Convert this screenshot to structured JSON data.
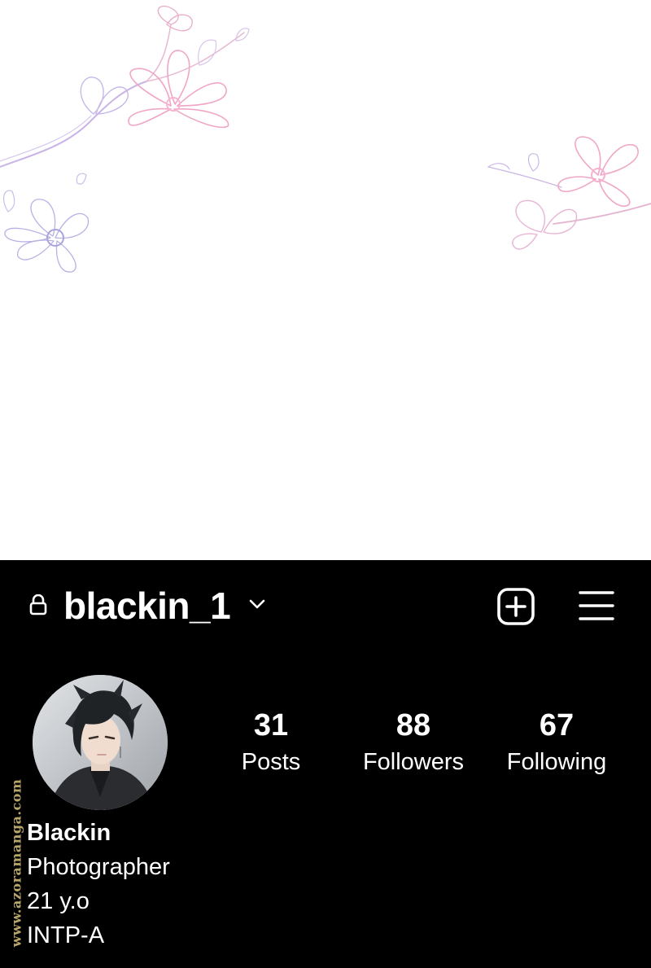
{
  "header": {
    "username": "blackin_1",
    "icons": [
      "lock-icon",
      "chevron-down-icon",
      "new-post-icon",
      "menu-icon"
    ]
  },
  "stats": [
    {
      "value": "31",
      "label": "Posts"
    },
    {
      "value": "88",
      "label": "Followers"
    },
    {
      "value": "67",
      "label": "Following"
    }
  ],
  "bio": {
    "name": "Blackin",
    "lines": [
      "Photographer",
      "21 y.o",
      "INTP-A"
    ]
  },
  "watermark": "www.azoramanga.com",
  "colors": {
    "profile_background": "#000000",
    "text": "#ffffff",
    "flower_pink": "#f2a8c8",
    "flower_lavender": "#b9b4e6",
    "watermark": "#b8a56a"
  }
}
